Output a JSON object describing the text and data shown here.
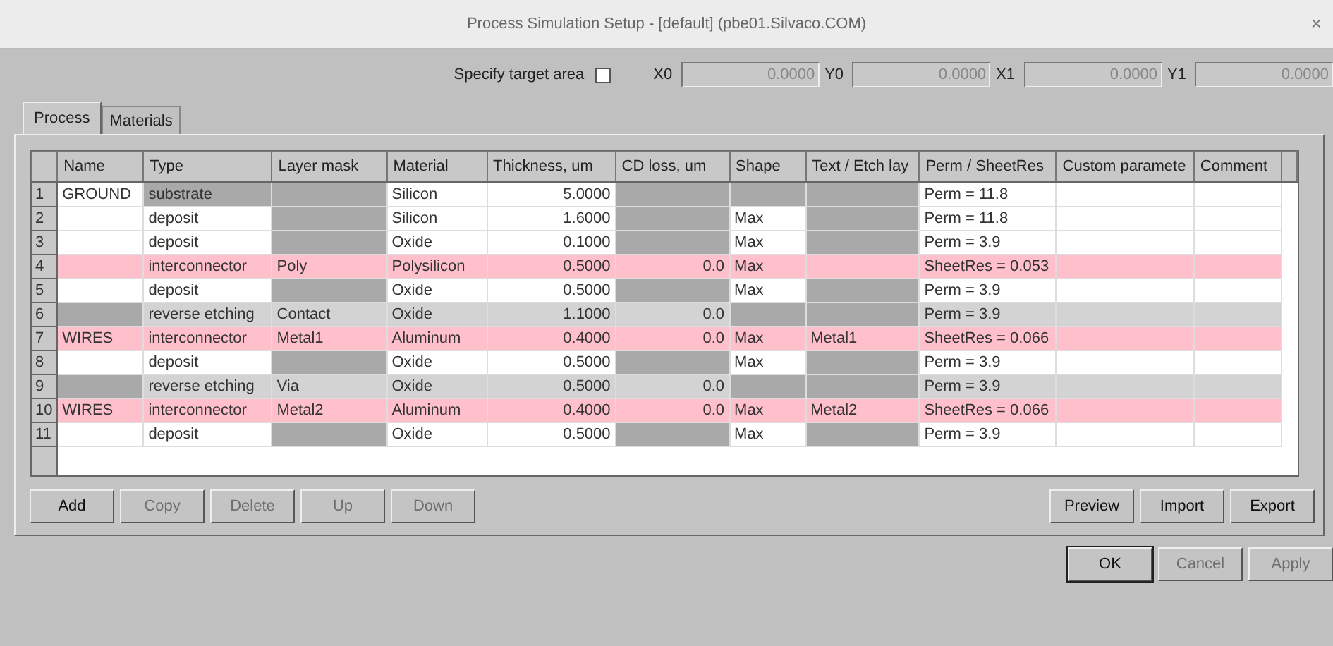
{
  "window": {
    "title": "Process Simulation Setup - [default] (pbe01.Silvaco.COM)",
    "close": "×"
  },
  "target": {
    "label": "Specify target area",
    "checked": false,
    "fields": [
      {
        "label": "X0",
        "value": "0.0000",
        "disabled": true
      },
      {
        "label": "Y0",
        "value": "0.0000",
        "disabled": true
      },
      {
        "label": "X1",
        "value": "0.0000",
        "disabled": true
      },
      {
        "label": "Y1",
        "value": "0.0000",
        "disabled": true
      }
    ]
  },
  "tabs": [
    {
      "label": "Process",
      "selected": true
    },
    {
      "label": "Materials",
      "selected": false
    }
  ],
  "table": {
    "columns": [
      {
        "label": "Name",
        "kind": "text"
      },
      {
        "label": "Type",
        "kind": "text"
      },
      {
        "label": "Layer mask",
        "kind": "text"
      },
      {
        "label": "Material",
        "kind": "text"
      },
      {
        "label": "Thickness, um",
        "kind": "number"
      },
      {
        "label": "CD loss, um",
        "kind": "number"
      },
      {
        "label": "Shape",
        "kind": "text"
      },
      {
        "label": "Text / Etch lay",
        "kind": "text"
      },
      {
        "label": "Perm / SheetRes",
        "kind": "text"
      },
      {
        "label": "Custom paramete",
        "kind": "text"
      },
      {
        "label": "Comment",
        "kind": "text"
      }
    ],
    "rows": [
      {
        "number": "1",
        "kind": "plain",
        "cells": [
          {
            "text": "GROUND",
            "disabled": false
          },
          {
            "text": "substrate",
            "disabled": true
          },
          {
            "disabled": true
          },
          {
            "text": "Silicon",
            "disabled": false
          },
          {
            "text": "5.0000",
            "disabled": false
          },
          {
            "disabled": true
          },
          {
            "disabled": true
          },
          {
            "disabled": true
          },
          {
            "text": "Perm = 11.8",
            "disabled": false
          },
          {
            "disabled": false
          },
          {
            "disabled": false
          }
        ]
      },
      {
        "number": "2",
        "kind": "plain",
        "cells": [
          {
            "disabled": false
          },
          {
            "text": "deposit",
            "disabled": false
          },
          {
            "disabled": true
          },
          {
            "text": "Silicon",
            "disabled": false
          },
          {
            "text": "1.6000",
            "disabled": false
          },
          {
            "disabled": true
          },
          {
            "text": "Max",
            "disabled": false
          },
          {
            "disabled": true
          },
          {
            "text": "Perm = 11.8",
            "disabled": false
          },
          {
            "disabled": false
          },
          {
            "disabled": false
          }
        ]
      },
      {
        "number": "3",
        "kind": "plain",
        "cells": [
          {
            "disabled": false
          },
          {
            "text": "deposit",
            "disabled": false
          },
          {
            "disabled": true
          },
          {
            "text": "Oxide",
            "disabled": false
          },
          {
            "text": "0.1000",
            "disabled": false
          },
          {
            "disabled": true
          },
          {
            "text": "Max",
            "disabled": false
          },
          {
            "disabled": true
          },
          {
            "text": "Perm = 3.9",
            "disabled": false
          },
          {
            "disabled": false
          },
          {
            "disabled": false
          }
        ]
      },
      {
        "number": "4",
        "kind": "interconnect",
        "cells": [
          {
            "disabled": false
          },
          {
            "text": "interconnector",
            "disabled": false
          },
          {
            "text": "Poly",
            "disabled": false
          },
          {
            "text": "Polysilicon",
            "disabled": false
          },
          {
            "text": "0.5000",
            "disabled": false
          },
          {
            "text": "0.0",
            "disabled": false
          },
          {
            "text": "Max",
            "disabled": false
          },
          {
            "disabled": false
          },
          {
            "text": "SheetRes = 0.053",
            "disabled": false
          },
          {
            "disabled": false
          },
          {
            "disabled": false
          }
        ]
      },
      {
        "number": "5",
        "kind": "plain",
        "cells": [
          {
            "disabled": false
          },
          {
            "text": "deposit",
            "disabled": false
          },
          {
            "disabled": true
          },
          {
            "text": "Oxide",
            "disabled": false
          },
          {
            "text": "0.5000",
            "disabled": false
          },
          {
            "disabled": true
          },
          {
            "text": "Max",
            "disabled": false
          },
          {
            "disabled": true
          },
          {
            "text": "Perm = 3.9",
            "disabled": false
          },
          {
            "disabled": false
          },
          {
            "disabled": false
          }
        ]
      },
      {
        "number": "6",
        "kind": "etch",
        "cells": [
          {
            "disabled": true
          },
          {
            "text": "reverse etching",
            "disabled": false
          },
          {
            "text": "Contact",
            "disabled": false
          },
          {
            "text": "Oxide",
            "disabled": false
          },
          {
            "text": "1.1000",
            "disabled": false
          },
          {
            "text": "0.0",
            "disabled": false
          },
          {
            "disabled": true
          },
          {
            "disabled": true
          },
          {
            "text": "Perm = 3.9",
            "disabled": false
          },
          {
            "disabled": false
          },
          {
            "disabled": false
          }
        ]
      },
      {
        "number": "7",
        "kind": "interconnect",
        "cells": [
          {
            "text": "WIRES",
            "disabled": false
          },
          {
            "text": "interconnector",
            "disabled": false
          },
          {
            "text": "Metal1",
            "disabled": false
          },
          {
            "text": "Aluminum",
            "disabled": false
          },
          {
            "text": "0.4000",
            "disabled": false
          },
          {
            "text": "0.0",
            "disabled": false
          },
          {
            "text": "Max",
            "disabled": false
          },
          {
            "text": "Metal1",
            "disabled": false
          },
          {
            "text": "SheetRes = 0.066",
            "disabled": false
          },
          {
            "disabled": false
          },
          {
            "disabled": false
          }
        ]
      },
      {
        "number": "8",
        "kind": "plain",
        "cells": [
          {
            "disabled": false
          },
          {
            "text": "deposit",
            "disabled": false
          },
          {
            "disabled": true
          },
          {
            "text": "Oxide",
            "disabled": false
          },
          {
            "text": "0.5000",
            "disabled": false
          },
          {
            "disabled": true
          },
          {
            "text": "Max",
            "disabled": false
          },
          {
            "disabled": true
          },
          {
            "text": "Perm = 3.9",
            "disabled": false
          },
          {
            "disabled": false
          },
          {
            "disabled": false
          }
        ]
      },
      {
        "number": "9",
        "kind": "etch",
        "cells": [
          {
            "disabled": true
          },
          {
            "text": "reverse etching",
            "disabled": false
          },
          {
            "text": "Via",
            "disabled": false
          },
          {
            "text": "Oxide",
            "disabled": false
          },
          {
            "text": "0.5000",
            "disabled": false
          },
          {
            "text": "0.0",
            "disabled": false
          },
          {
            "disabled": true
          },
          {
            "disabled": true
          },
          {
            "text": "Perm = 3.9",
            "disabled": false
          },
          {
            "disabled": false
          },
          {
            "disabled": false
          }
        ]
      },
      {
        "number": "10",
        "kind": "interconnect",
        "cells": [
          {
            "text": "WIRES",
            "disabled": false
          },
          {
            "text": "interconnector",
            "disabled": false
          },
          {
            "text": "Metal2",
            "disabled": false
          },
          {
            "text": "Aluminum",
            "disabled": false
          },
          {
            "text": "0.4000",
            "disabled": false
          },
          {
            "text": "0.0",
            "disabled": false
          },
          {
            "text": "Max",
            "disabled": false
          },
          {
            "text": "Metal2",
            "disabled": false
          },
          {
            "text": "SheetRes = 0.066",
            "disabled": false
          },
          {
            "disabled": false
          },
          {
            "disabled": false
          }
        ]
      },
      {
        "number": "11",
        "kind": "plain",
        "cells": [
          {
            "disabled": false
          },
          {
            "text": "deposit",
            "disabled": false
          },
          {
            "disabled": true
          },
          {
            "text": "Oxide",
            "disabled": false
          },
          {
            "text": "0.5000",
            "disabled": false
          },
          {
            "disabled": true
          },
          {
            "text": "Max",
            "disabled": false
          },
          {
            "disabled": true
          },
          {
            "text": "Perm = 3.9",
            "disabled": false
          },
          {
            "disabled": false
          },
          {
            "disabled": false
          }
        ]
      }
    ]
  },
  "table_buttons_left": [
    {
      "label": "Add",
      "disabled": false
    },
    {
      "label": "Copy",
      "disabled": true
    },
    {
      "label": "Delete",
      "disabled": true
    },
    {
      "label": "Up",
      "disabled": true
    },
    {
      "label": "Down",
      "disabled": true
    }
  ],
  "table_buttons_right": [
    {
      "label": "Preview",
      "disabled": false
    },
    {
      "label": "Import",
      "disabled": false
    },
    {
      "label": "Export",
      "disabled": false
    }
  ],
  "dialog_buttons": [
    {
      "label": "OK",
      "disabled": false
    },
    {
      "label": "Cancel",
      "disabled": true
    },
    {
      "label": "Apply",
      "disabled": true
    }
  ]
}
